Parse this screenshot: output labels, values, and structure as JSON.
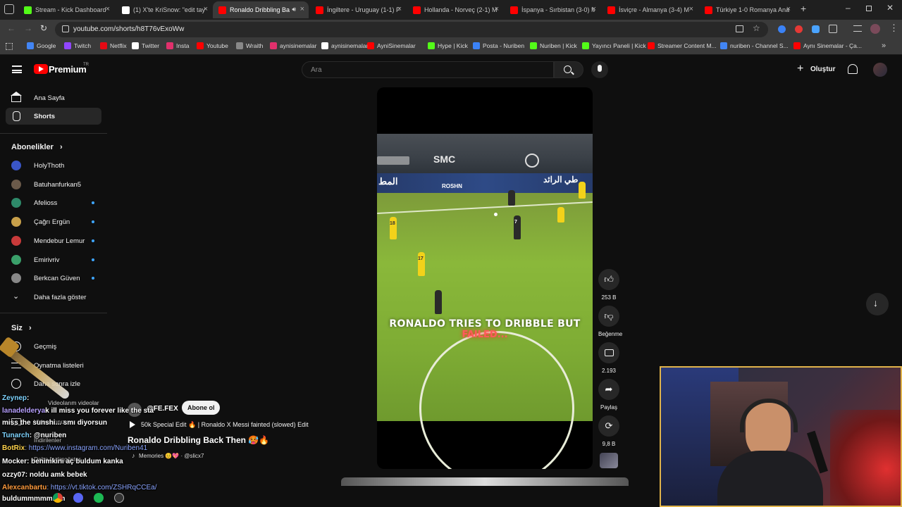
{
  "browser": {
    "tabs": [
      {
        "title": "Stream - Kick Dashboard",
        "color": "#53fc18"
      },
      {
        "title": "(1) X'te KriSnow: \"edit tay",
        "color": "#ffffff"
      },
      {
        "title": "Ronaldo Dribbling Ba",
        "color": "#ff0000"
      },
      {
        "title": "İngiltere - Uruguay (1-1) F",
        "color": "#ff0000"
      },
      {
        "title": "Hollanda - Norveç (2-1) M",
        "color": "#ff0000"
      },
      {
        "title": "İspanya - Sırbistan (3-0) M",
        "color": "#ff0000"
      },
      {
        "title": "İsviçre - Almanya (3-4) M",
        "color": "#ff0000"
      },
      {
        "title": "Türkiye 1-0 Romanya Ana",
        "color": "#ff0000"
      }
    ],
    "url": "youtube.com/shorts/h8T76vExoWw",
    "bookmarks": [
      {
        "label": "Google",
        "color": "#4285f4"
      },
      {
        "label": "Twitch",
        "color": "#9146ff"
      },
      {
        "label": "Netflix",
        "color": "#e50914"
      },
      {
        "label": "Twitter",
        "color": "#ffffff"
      },
      {
        "label": "Insta",
        "color": "#e1306c"
      },
      {
        "label": "Youtube",
        "color": "#ff0000"
      },
      {
        "label": "Wraith",
        "color": "#888888"
      },
      {
        "label": "aynisinemalar",
        "color": "#e1306c"
      },
      {
        "label": "aynisinemalar",
        "color": "#ffffff"
      },
      {
        "label": "AyniSinemalar",
        "color": "#ff0000"
      },
      {
        "label": "Hype | Kick",
        "color": "#53fc18"
      },
      {
        "label": "Posta - Nuriben",
        "color": "#3b82f6"
      },
      {
        "label": "Nuriben | Kick",
        "color": "#53fc18"
      },
      {
        "label": "Yayıncı Paneli | Kick",
        "color": "#53fc18"
      },
      {
        "label": "Streamer Content M...",
        "color": "#ff0000"
      },
      {
        "label": "nuriben - Channel S...",
        "color": "#4285f4"
      },
      {
        "label": "Aynı Sinemalar - Ça...",
        "color": "#ff0000"
      }
    ]
  },
  "youtube": {
    "logo_text": "Premium",
    "logo_sup": "TR",
    "search_placeholder": "Ara",
    "create_label": "Oluştur"
  },
  "sidebar": {
    "home": "Ana Sayfa",
    "shorts": "Shorts",
    "subs_heading": "Abonelikler",
    "subs": [
      {
        "name": "HolyThoth",
        "dot": false,
        "color": "#3a56c8"
      },
      {
        "name": "Batuhanfurkan5",
        "dot": false,
        "color": "#6b5a4a"
      },
      {
        "name": "Afelioss",
        "dot": true,
        "color": "#2e8a6a"
      },
      {
        "name": "Çağrı Ergün",
        "dot": true,
        "color": "#c8a04a"
      },
      {
        "name": "Mendebur Lemur",
        "dot": true,
        "color": "#c83a3a"
      },
      {
        "name": "Emirivriv",
        "dot": true,
        "color": "#3aa06a"
      },
      {
        "name": "Berkcan Güven",
        "dot": true,
        "color": "#888888"
      }
    ],
    "show_more": "Daha fazla göster",
    "you_heading": "Siz",
    "you_items": [
      "Geçmiş",
      "Oynatma listeleri",
      "Daha sonra izle",
      "Videolarım videolar",
      "Videolarınız",
      "İndirilenler",
      "Daha fazla göster"
    ]
  },
  "short": {
    "caption_main": "RONALDO TRIES TO DRIBBLE BUT",
    "caption_sub": "FAILED...",
    "channel": "@FE.FEX",
    "subscribe": "Abone ol",
    "desc_line": "50k Special Edit 🔥 | Ronaldo X Messi fainted (slowed) Edit",
    "title": "Ronaldo Dribbling Back Then 🥵🔥",
    "music": "Memories 😊💖 · @slicx7",
    "like_count": "253 B",
    "dislike_label": "Beğenme",
    "comment_count": "2.193",
    "share_label": "Paylaş",
    "remix_count": "9,8 B",
    "board_left": "المط",
    "board_right": "طي الرائد",
    "board_center": "ROSHN",
    "sponsor": "SMC",
    "jersey_a": "18",
    "jersey_b": "17",
    "jersey_c": "7"
  },
  "chat": [
    {
      "user": "Zeynep",
      "text": ": ",
      "color": "#7fd4ff"
    },
    {
      "user": "lanadelderya",
      "text": "k ill miss you forever like the sta",
      "color": "#b7a0ff"
    },
    {
      "user": "",
      "text": "miss the sunshi... smı diyorsun",
      "color": "#ffffff"
    },
    {
      "user": "Tunarch",
      "text": ": @nuriben",
      "color": "#7fd4ff"
    },
    {
      "user": "BotRix",
      "text": ": https://www.instagram.com/Nuriben41",
      "color": "#ffd34d"
    },
    {
      "user": "Mocker",
      "text": ": benimkini aç buldum kanka",
      "color": "#ffffff"
    },
    {
      "user": "ozzy07",
      "text": ": noldu amk bebek",
      "color": "#ffffff"
    },
    {
      "user": "Alexcanbartu",
      "text": ": https://vt.tiktok.com/ZSHRqCCEa/",
      "color": "#ff9b3d"
    },
    {
      "user": "",
      "text": "buldummmmmmm",
      "color": "#ffffff"
    }
  ]
}
